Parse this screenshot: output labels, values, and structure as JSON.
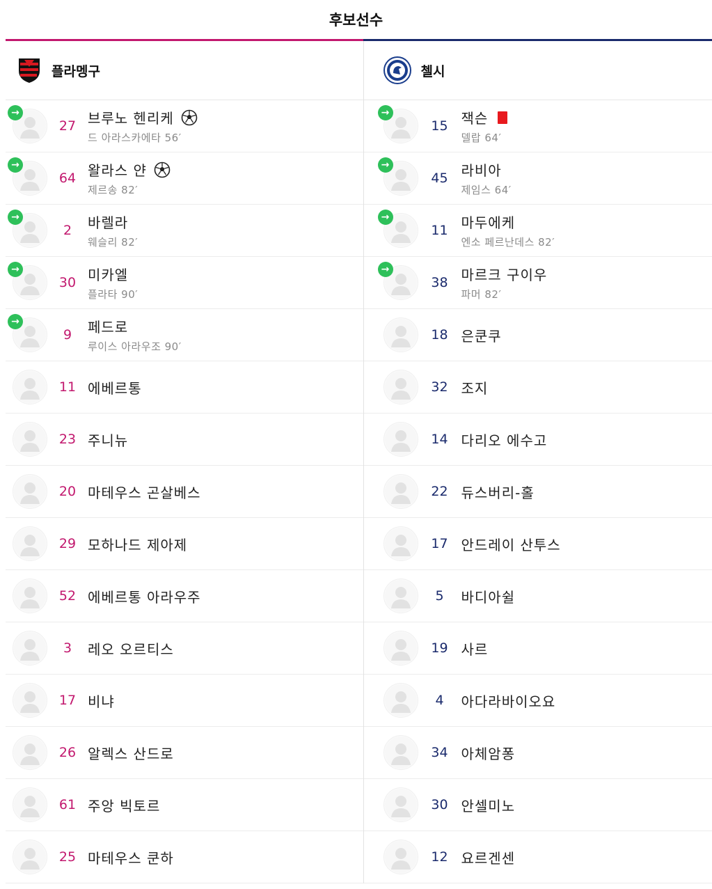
{
  "header": {
    "title": "후보선수"
  },
  "colors": {
    "home_accent": "#c2186e",
    "away_accent": "#1a2a6c",
    "sub_badge": "#2ec05a",
    "red_card": "#e8191e"
  },
  "home": {
    "name": "플라멩구",
    "logo_icon": "flamengo-crest-icon",
    "players": [
      {
        "number": "27",
        "name": "브루노 헨리케",
        "sub": "드 아라스카에타 56′",
        "subbed_in": true,
        "event": "goal"
      },
      {
        "number": "64",
        "name": "왈라스 얀",
        "sub": "제르송 82′",
        "subbed_in": true,
        "event": "goal"
      },
      {
        "number": "2",
        "name": "바렐라",
        "sub": "웨슬리 82′",
        "subbed_in": true,
        "event": ""
      },
      {
        "number": "30",
        "name": "미카엘",
        "sub": "플라타 90′",
        "subbed_in": true,
        "event": ""
      },
      {
        "number": "9",
        "name": "페드로",
        "sub": "루이스 아라우조 90′",
        "subbed_in": true,
        "event": ""
      },
      {
        "number": "11",
        "name": "에베르통",
        "sub": "",
        "subbed_in": false,
        "event": ""
      },
      {
        "number": "23",
        "name": "주니뉴",
        "sub": "",
        "subbed_in": false,
        "event": ""
      },
      {
        "number": "20",
        "name": "마테우스 곤살베스",
        "sub": "",
        "subbed_in": false,
        "event": ""
      },
      {
        "number": "29",
        "name": "모하나드 제아제",
        "sub": "",
        "subbed_in": false,
        "event": ""
      },
      {
        "number": "52",
        "name": "에베르통 아라우주",
        "sub": "",
        "subbed_in": false,
        "event": ""
      },
      {
        "number": "3",
        "name": "레오 오르티스",
        "sub": "",
        "subbed_in": false,
        "event": ""
      },
      {
        "number": "17",
        "name": "비냐",
        "sub": "",
        "subbed_in": false,
        "event": ""
      },
      {
        "number": "26",
        "name": "알렉스 산드로",
        "sub": "",
        "subbed_in": false,
        "event": ""
      },
      {
        "number": "61",
        "name": "주앙 빅토르",
        "sub": "",
        "subbed_in": false,
        "event": ""
      },
      {
        "number": "25",
        "name": "마테우스 쿤하",
        "sub": "",
        "subbed_in": false,
        "event": ""
      }
    ]
  },
  "away": {
    "name": "첼시",
    "logo_icon": "chelsea-crest-icon",
    "players": [
      {
        "number": "15",
        "name": "잭슨",
        "sub": "델랍 64′",
        "subbed_in": true,
        "event": "red-card"
      },
      {
        "number": "45",
        "name": "라비아",
        "sub": "제임스 64′",
        "subbed_in": true,
        "event": ""
      },
      {
        "number": "11",
        "name": "마두에케",
        "sub": "엔소 페르난데스 82′",
        "subbed_in": true,
        "event": ""
      },
      {
        "number": "38",
        "name": "마르크 구이우",
        "sub": "파머 82′",
        "subbed_in": true,
        "event": ""
      },
      {
        "number": "18",
        "name": "은쿤쿠",
        "sub": "",
        "subbed_in": false,
        "event": ""
      },
      {
        "number": "32",
        "name": "조지",
        "sub": "",
        "subbed_in": false,
        "event": ""
      },
      {
        "number": "14",
        "name": "다리오 에수고",
        "sub": "",
        "subbed_in": false,
        "event": ""
      },
      {
        "number": "22",
        "name": "듀스버리-홀",
        "sub": "",
        "subbed_in": false,
        "event": ""
      },
      {
        "number": "17",
        "name": "안드레이 산투스",
        "sub": "",
        "subbed_in": false,
        "event": ""
      },
      {
        "number": "5",
        "name": "바디아쉴",
        "sub": "",
        "subbed_in": false,
        "event": ""
      },
      {
        "number": "19",
        "name": "사르",
        "sub": "",
        "subbed_in": false,
        "event": ""
      },
      {
        "number": "4",
        "name": "아다라바이오요",
        "sub": "",
        "subbed_in": false,
        "event": ""
      },
      {
        "number": "34",
        "name": "아체암퐁",
        "sub": "",
        "subbed_in": false,
        "event": ""
      },
      {
        "number": "30",
        "name": "안셀미노",
        "sub": "",
        "subbed_in": false,
        "event": ""
      },
      {
        "number": "12",
        "name": "요르겐센",
        "sub": "",
        "subbed_in": false,
        "event": ""
      }
    ]
  }
}
